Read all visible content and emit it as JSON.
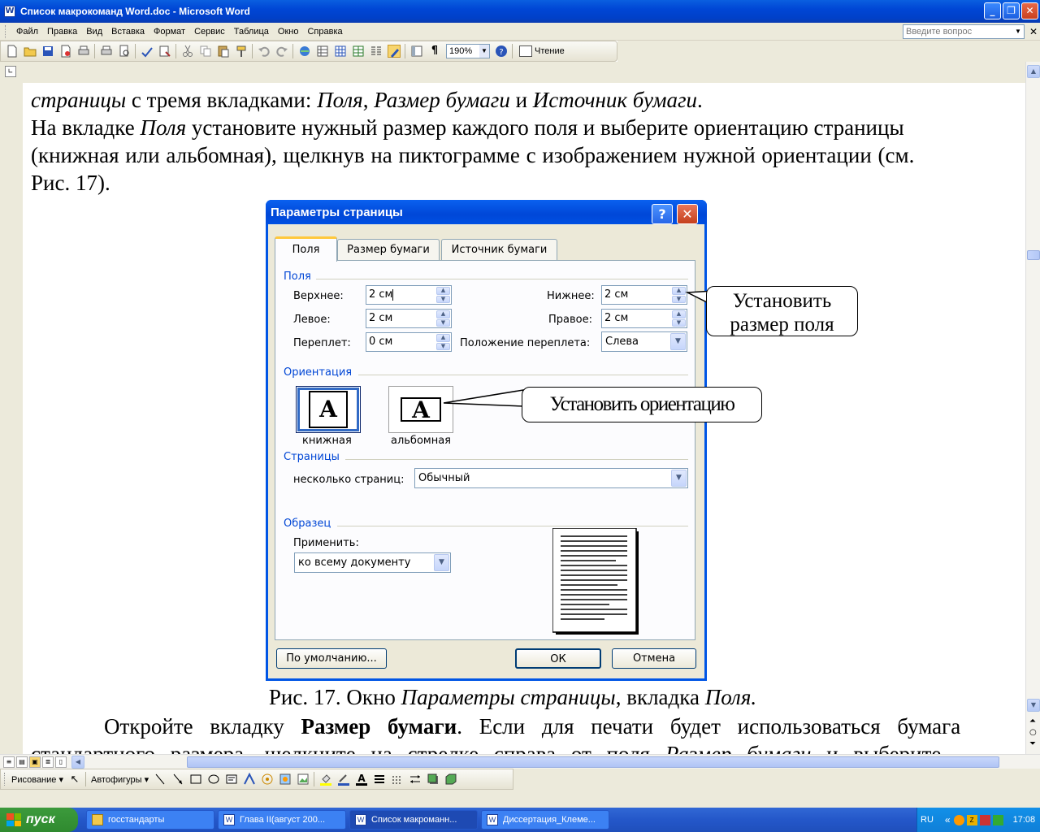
{
  "window": {
    "title": "Список макрокоманд Word.doc - Microsoft Word",
    "app_icon": "W"
  },
  "menu": {
    "items": [
      "Файл",
      "Правка",
      "Вид",
      "Вставка",
      "Формат",
      "Сервис",
      "Таблица",
      "Окно",
      "Справка"
    ],
    "ask_placeholder": "Введите вопрос"
  },
  "toolbar": {
    "zoom": "190%",
    "read_label": "Чтение"
  },
  "document": {
    "line1_italic_a": "страницы",
    "line1_plain_a": " с тремя вкладками: ",
    "line1_italic_b": "Поля",
    "line1_plain_b": ", ",
    "line1_italic_c": "Размер бумаги",
    "line1_plain_c": " и ",
    "line1_italic_d": "Источник бумаги",
    "line1_plain_d": ".",
    "line2_plain_a": "На вкладке ",
    "line2_italic": "Поля",
    "line2_plain_b": " установите нужный размер каждого поля и выберите ориентацию страницы",
    "line3": "(книжная или альбомная), щелкнув на пиктограмме с изображением нужной ориентации (см.",
    "line4": "Рис. 17).",
    "caption_plain_a": "Рис. 17. Окно ",
    "caption_italic_a": "Параметры страницы",
    "caption_plain_b": ", вкладка ",
    "caption_italic_b": "Поля.",
    "para2_plain_a": "Откройте вкладку ",
    "para2_bold": "Размер бумаги",
    "para2_plain_b": ". Если для печати будет использоваться бумага",
    "para2_line2_plain": "стандартного размера, щелкните на стрелке справа от поля ",
    "para2_line2_italic": "Размер бумаги",
    "para2_line2_end": " и выберите"
  },
  "dialog": {
    "title": "Параметры страницы",
    "tabs": [
      "Поля",
      "Размер бумаги",
      "Источник бумаги"
    ],
    "group_fields": "Поля",
    "top_label": "Верхнее:",
    "top_value": "2 см",
    "bottom_label": "Нижнее:",
    "bottom_value": "2 см",
    "left_label": "Левое:",
    "left_value": "2 см",
    "right_label": "Правое:",
    "right_value": "2 см",
    "gutter_label": "Переплет:",
    "gutter_value": "0 см",
    "gutter_pos_label": "Положение переплета:",
    "gutter_pos_value": "Слева",
    "group_orientation": "Ориентация",
    "portrait_label": "книжная",
    "landscape_label": "альбомная",
    "page_glyph": "A",
    "group_pages": "Страницы",
    "multiple_pages_label": "несколько страниц:",
    "multiple_pages_value": "Обычный",
    "group_preview": "Образец",
    "apply_label": "Применить:",
    "apply_value": "ко всему документу",
    "default_button": "По умолчанию...",
    "ok_button": "ОК",
    "cancel_button": "Отмена"
  },
  "callouts": {
    "margins_line1": "Установить",
    "margins_line2": "размер поля",
    "orientation": "Установить ориентацию"
  },
  "drawing_toolbar": {
    "drawing_label": "Рисование",
    "autoshapes_label": "Автофигуры"
  },
  "taskbar": {
    "start_label": "пуск",
    "tasks": [
      "госстандарты",
      "Глава II(август 200...",
      "Список макроманн...",
      "Диссертация_Клеме..."
    ],
    "language": "RU",
    "clock": "17:08"
  },
  "colors": {
    "xp_blue": "#0055e5",
    "start_green": "#3c9a3c",
    "dialog_face": "#ece9d8",
    "group_label": "#0046d5"
  }
}
